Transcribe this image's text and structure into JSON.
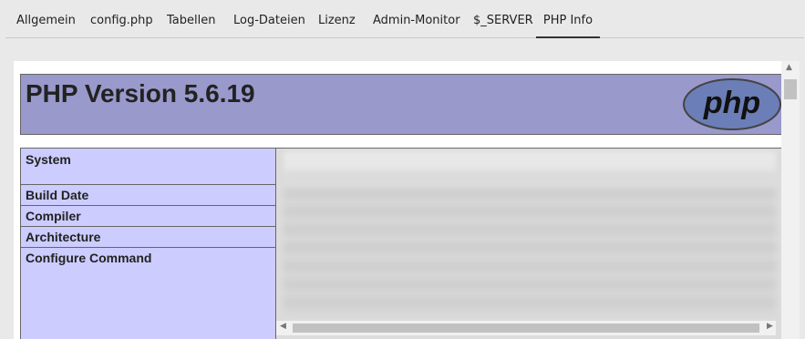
{
  "tabs": [
    {
      "label": "Allgemein"
    },
    {
      "label": "config.php"
    },
    {
      "label": "Tabellen"
    },
    {
      "label": "Log-Dateien"
    },
    {
      "label": "Lizenz"
    },
    {
      "label": "Admin-Monitor"
    },
    {
      "label": "$_SERVER"
    },
    {
      "label": "PHP Info",
      "active": true
    }
  ],
  "phpinfo": {
    "title": "PHP Version 5.6.19",
    "logo_text": "php",
    "rows": [
      {
        "label": "System"
      },
      {
        "label": "Build Date"
      },
      {
        "label": "Compiler"
      },
      {
        "label": "Architecture"
      },
      {
        "label": "Configure Command"
      }
    ]
  },
  "colors": {
    "header_bg": "#9999cc",
    "label_bg": "#ccccff",
    "logo_bg": "#6c7eb7"
  }
}
